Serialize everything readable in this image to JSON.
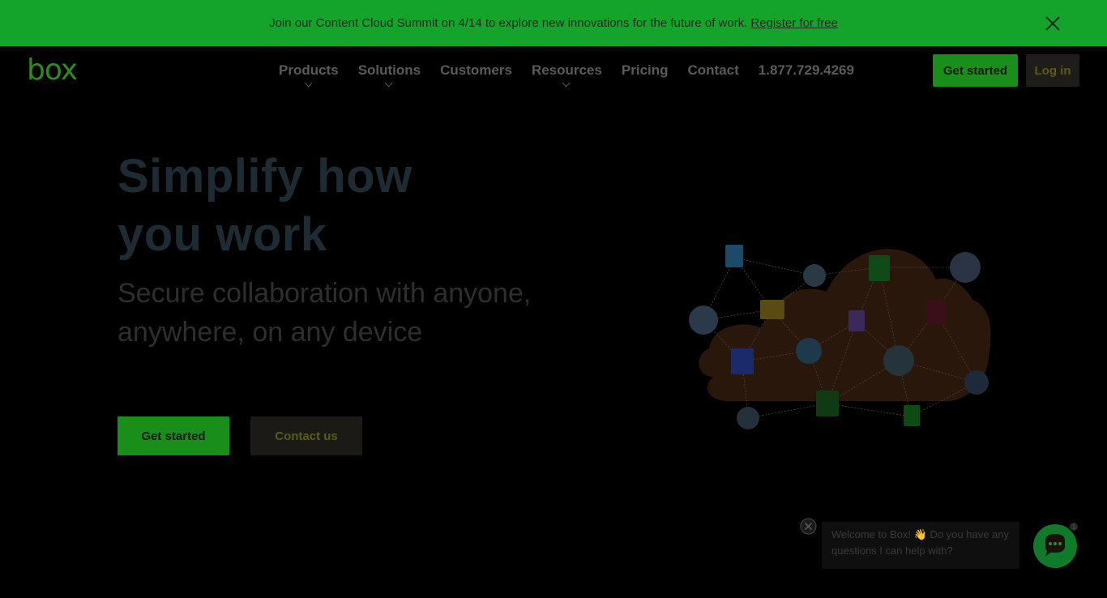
{
  "banner": {
    "message": "Join our Content Cloud Summit on 4/14 to explore new innovations for the future of work.",
    "link": "Register for free"
  },
  "nav": {
    "logo": "box",
    "menu": [
      {
        "label": "Products",
        "has_dropdown": true
      },
      {
        "label": "Solutions",
        "has_dropdown": true
      },
      {
        "label": "Customers",
        "has_dropdown": false
      },
      {
        "label": "Resources",
        "has_dropdown": true
      },
      {
        "label": "Pricing",
        "has_dropdown": false
      },
      {
        "label": "Contact",
        "has_dropdown": false
      },
      {
        "label": "1.877.729.4269",
        "has_dropdown": false
      }
    ],
    "get_started": "Get started",
    "login": "Log in"
  },
  "hero": {
    "title_line1": "Simplify how",
    "title_line2": "you work",
    "subtitle": "Secure collaboration with anyone, anywhere, on any device",
    "cta_primary": "Get started",
    "cta_secondary": "Contact us"
  },
  "chat": {
    "message": "Welcome to Box! 👋 Do you have any questions I can help with?",
    "badge": "1"
  },
  "colors": {
    "brand_green": "#14a42b",
    "button_green": "#1a8e1a",
    "background": "#000000"
  }
}
